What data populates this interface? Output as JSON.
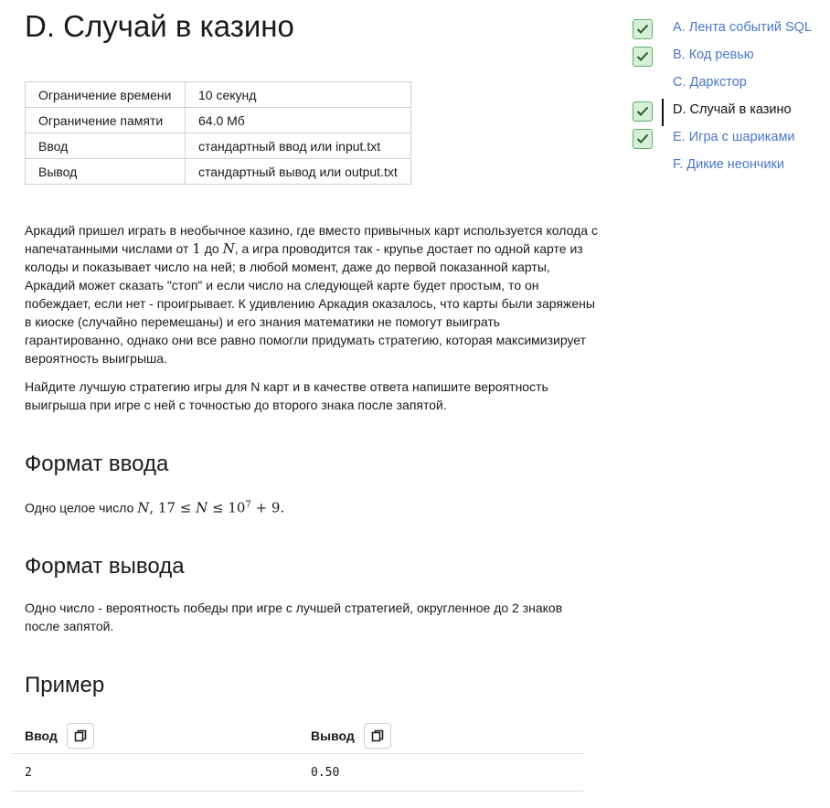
{
  "problem": {
    "title": "D. Случай в казино",
    "limits": [
      {
        "key": "Ограничение времени",
        "value": "10 секунд"
      },
      {
        "key": "Ограничение памяти",
        "value": "64.0 Мб"
      },
      {
        "key": "Ввод",
        "value": "стандартный ввод или input.txt"
      },
      {
        "key": "Вывод",
        "value": "стандартный вывод или output.txt"
      }
    ],
    "statement": {
      "p1_a": "Аркадий пришел играть в необычное казино, где вместо привычных карт используется колода с напечатанными числами от ",
      "p1_one": "1",
      "p1_b": " до ",
      "p1_N": "N",
      "p1_c": ", а игра проводится так - крупье достает по одной карте из колоды и показывает число на ней; в любой момент, даже до первой показанной карты, Аркадий может сказать \"стоп\" и если число на следующей карте будет простым, то он побеждает, если нет - проигрывает. К удивлению Аркадия оказалось, что карты были заряжены в киоске (случайно перемешаны) и его знания математики не помогут выиграть гарантированно, однако они все равно помогли придумать стратегию, которая максимизирует вероятность выигрыша.",
      "p2": "Найдите лучшую стратегию игры для N карт и в качестве ответа напишите вероятность выигрыша при игре с ней с точностью до второго знака после запятой."
    },
    "input_format": {
      "heading": "Формат ввода",
      "text": "Одно целое число ",
      "N": "N",
      "c1": ", 17 ≤ ",
      "N2": "N",
      "c2": " ≤ 10",
      "exp": "7",
      "c3": " + 9."
    },
    "output_format": {
      "heading": "Формат вывода",
      "text": "Одно число - вероятность победы при игре с лучшей стратегией, округленное до 2 знаков после запятой."
    },
    "example": {
      "heading": "Пример",
      "input_label": "Ввод",
      "output_label": "Вывод",
      "input_value": "2",
      "output_value": "0.50"
    }
  },
  "sidebar": {
    "items": [
      {
        "label": "A. Лента событий SQL",
        "solved": true,
        "active": false
      },
      {
        "label": "B. Код ревью",
        "solved": true,
        "active": false
      },
      {
        "label": "C. Даркстор",
        "solved": false,
        "active": false
      },
      {
        "label": "D. Случай в казино",
        "solved": true,
        "active": true
      },
      {
        "label": "E. Игра с шариками",
        "solved": true,
        "active": false
      },
      {
        "label": "F. Дикие неончики",
        "solved": false,
        "active": false
      }
    ]
  },
  "colors": {
    "link": "#4a78c7",
    "check_bg": "#d7efd9",
    "check_border": "#5cae64"
  },
  "icons": {
    "copy": "copy-icon",
    "check": "checkmark-icon"
  }
}
